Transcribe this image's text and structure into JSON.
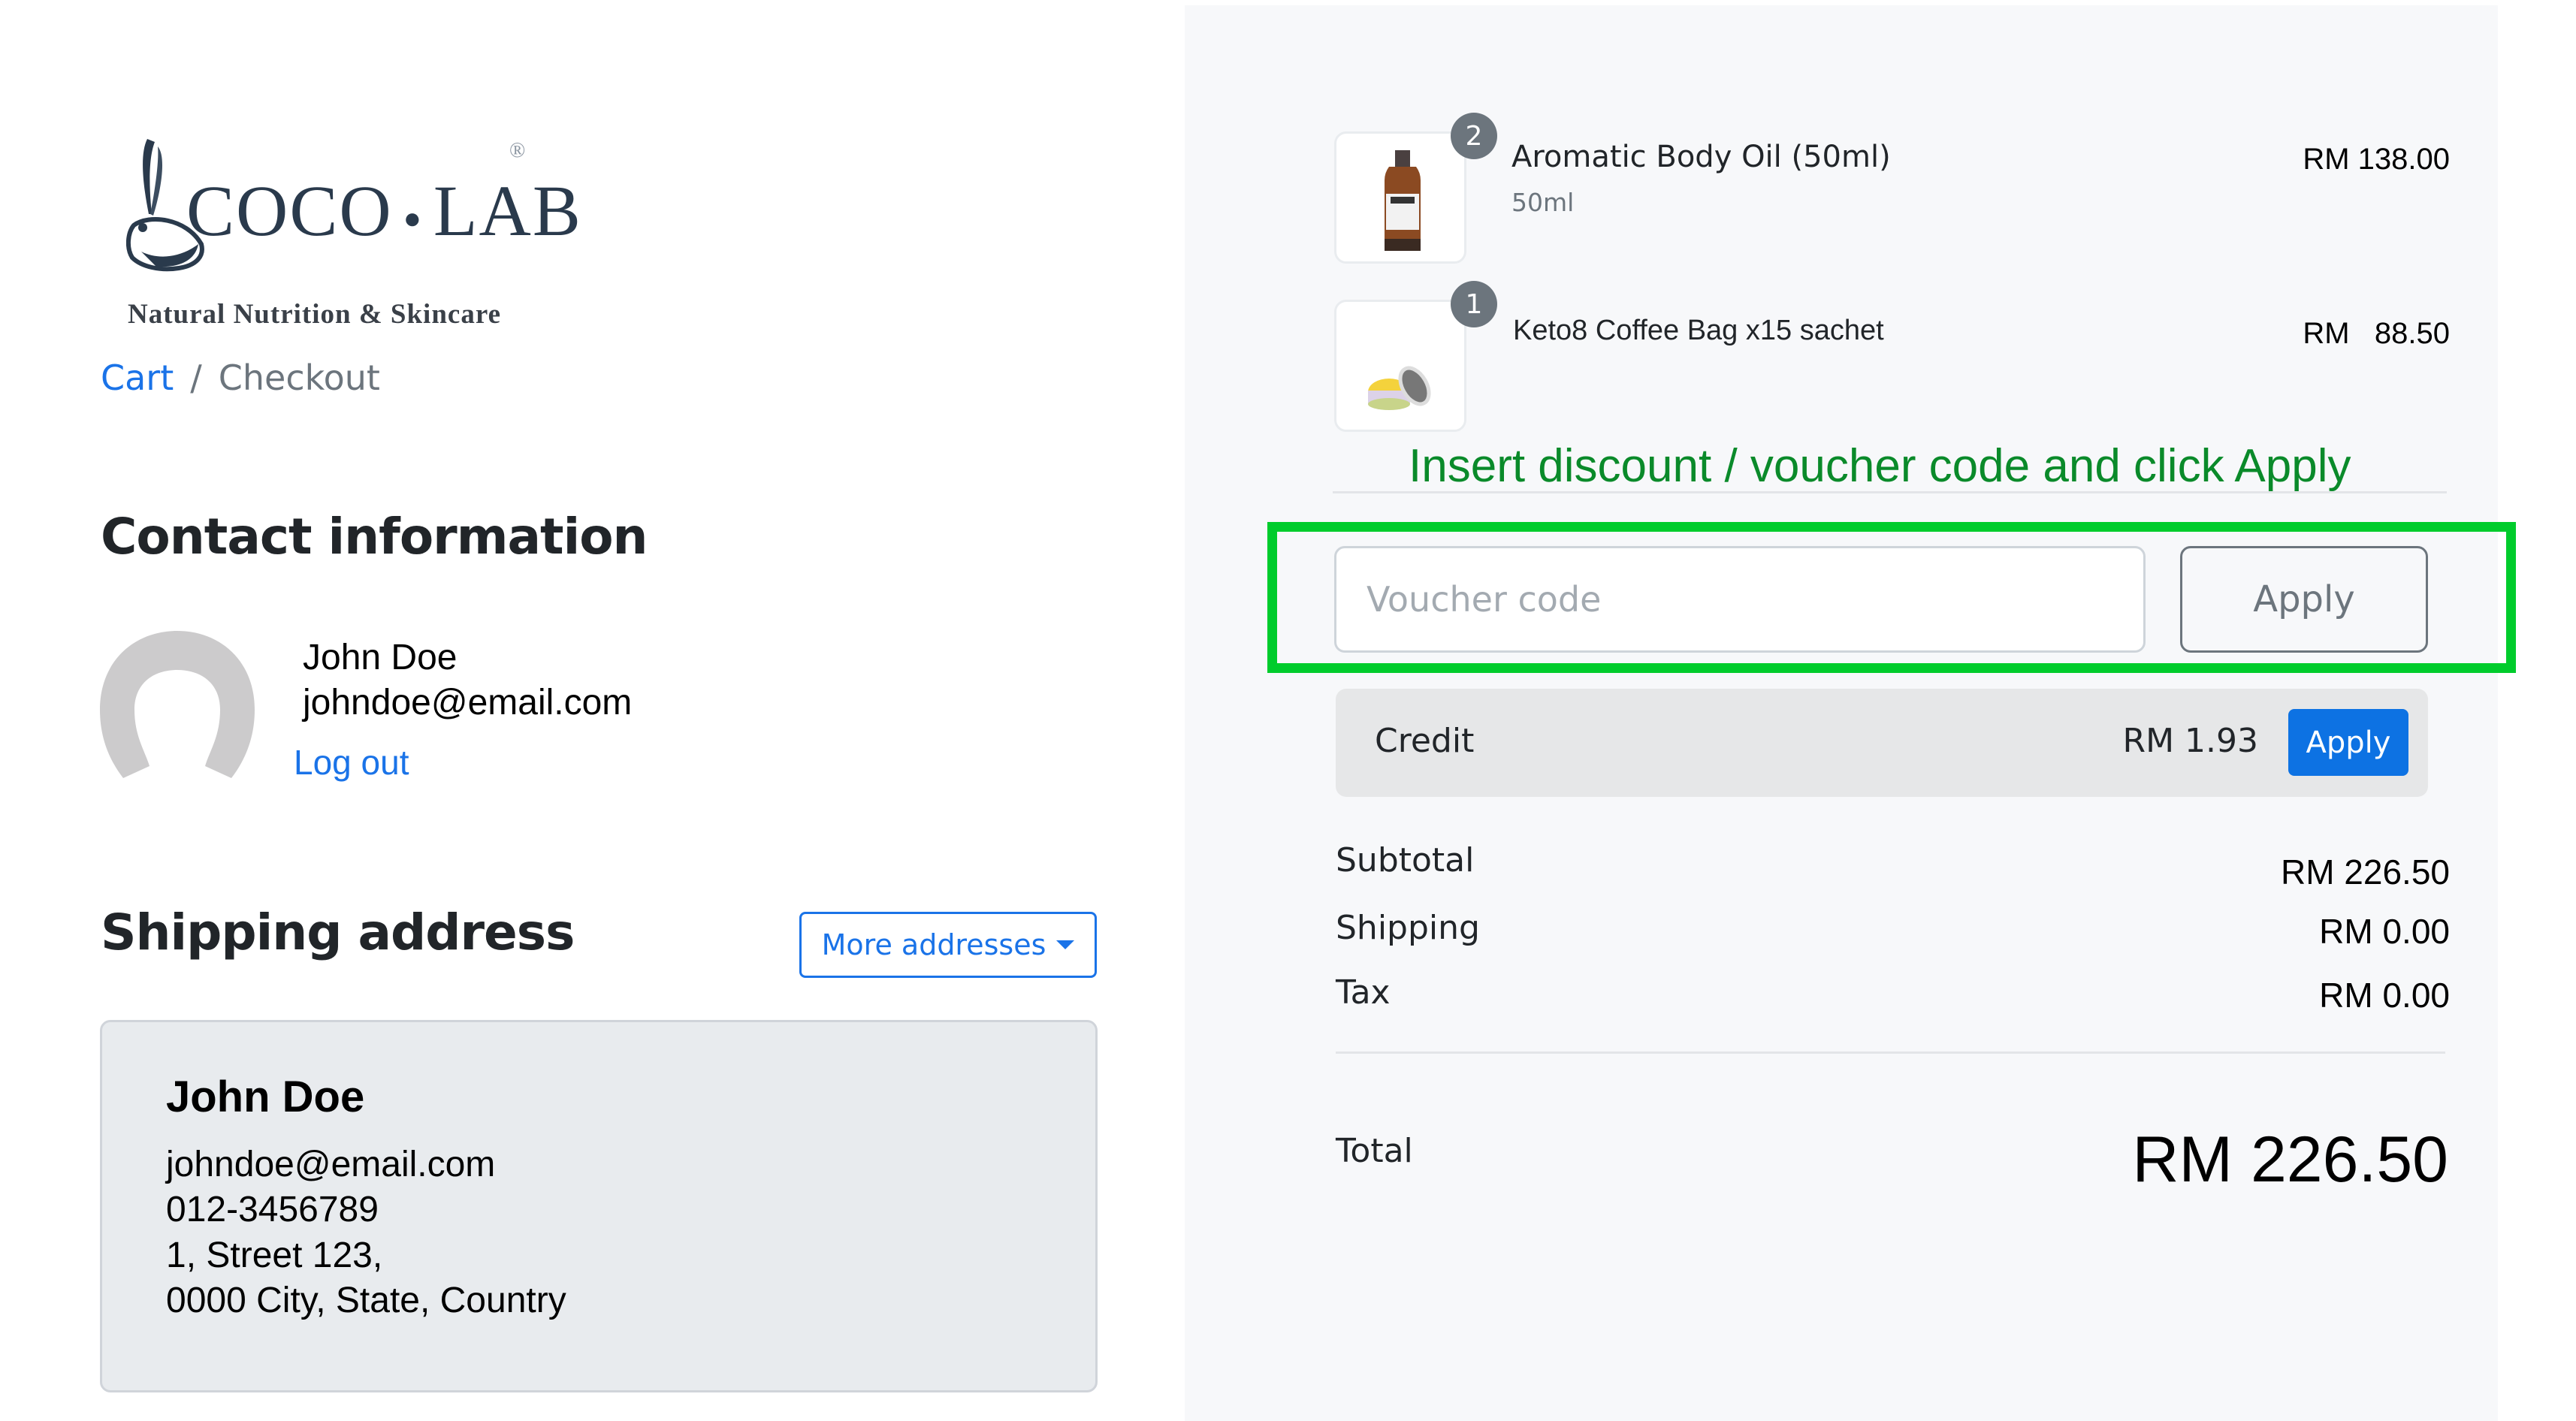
{
  "brand": {
    "name_left": "COCO",
    "name_right": "LAB",
    "registered": "®",
    "tagline": "Natural Nutrition & Skincare"
  },
  "breadcrumb": {
    "items": [
      {
        "label": "Cart",
        "link": true
      },
      {
        "label": "Checkout",
        "link": false
      }
    ],
    "separator": "/"
  },
  "contact": {
    "title": "Contact information",
    "name": "John Doe",
    "email": "johndoe@email.com",
    "logout_label": "Log out",
    "avatar_icon": "user-avatar-placeholder-icon"
  },
  "shipping": {
    "title": "Shipping address",
    "more_addresses_label": "More addresses",
    "address": {
      "name": "John Doe",
      "email": "johndoe@email.com",
      "phone": "012-3456789",
      "line1": "1, Street 123,",
      "line2": "0000 City, State, Country"
    }
  },
  "order": {
    "items": [
      {
        "name": "Aromatic Body Oil (50ml)",
        "variant": "50ml",
        "quantity": "2",
        "price": "RM 138.00",
        "image": "amber-bottle"
      },
      {
        "name": "Keto8 Coffee Bag x15 sachet",
        "variant": "",
        "quantity": "1",
        "price": "RM   88.50",
        "image": "open-jar"
      }
    ],
    "annotation": "Insert discount / voucher code and click Apply",
    "voucher": {
      "placeholder": "Voucher code",
      "value": "",
      "apply_label": "Apply"
    },
    "credit": {
      "label": "Credit",
      "amount": "RM 1.93",
      "apply_label": "Apply"
    },
    "summary": [
      {
        "label": "Subtotal",
        "value": "RM 226.50"
      },
      {
        "label": "Shipping",
        "value": "RM 0.00"
      },
      {
        "label": "Tax",
        "value": "RM 0.00"
      }
    ],
    "total": {
      "label": "Total",
      "value": "RM 226.50"
    }
  },
  "colors": {
    "link": "#1a73e8",
    "annotation_green": "#00cc2c",
    "annotation_text": "#0a8a2a",
    "primary_button": "#0d72e3",
    "badge": "#6c757d"
  }
}
